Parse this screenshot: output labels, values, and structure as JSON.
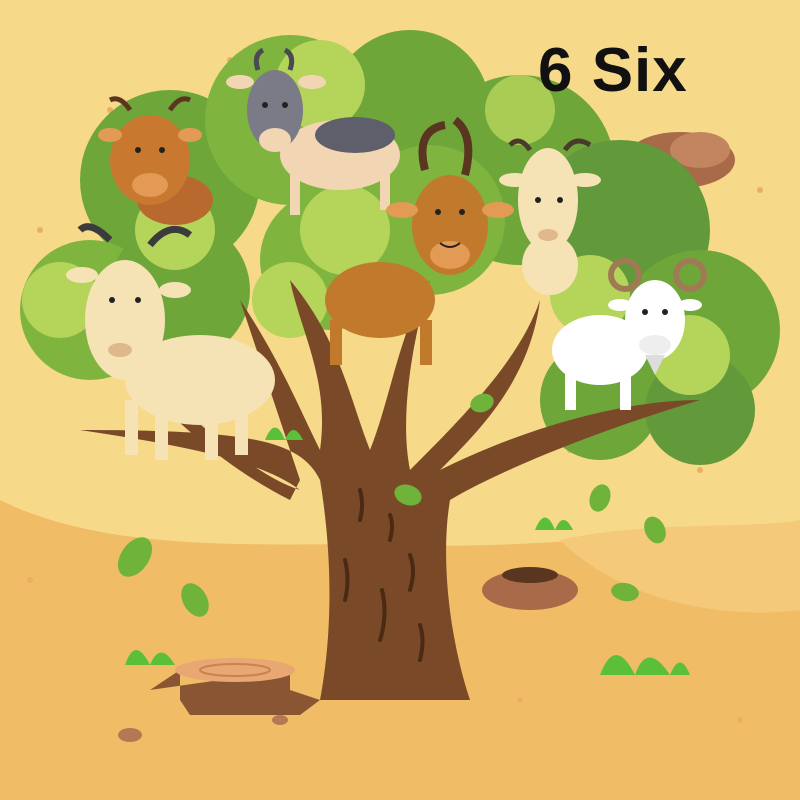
{
  "illustration": {
    "label": "6 Six",
    "goat_count": 6,
    "colors": {
      "background": "#f7d98a",
      "ground": "#f0bd66",
      "foliage_dark": "#6ea63a",
      "foliage_light": "#b5d45a",
      "trunk": "#7a4a28",
      "label_text": "#111111"
    }
  }
}
